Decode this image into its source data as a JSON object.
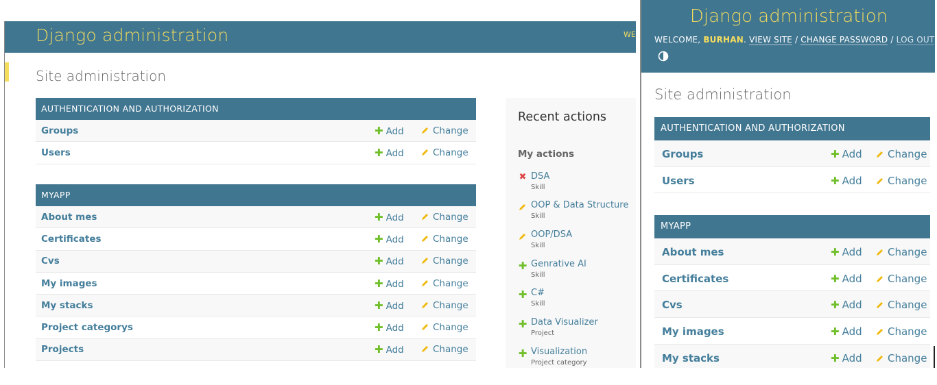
{
  "left": {
    "brand": "Django administration",
    "user_tools_fragment": "WE",
    "page_title": "Site administration",
    "modules": [
      {
        "caption": "AUTHENTICATION AND AUTHORIZATION",
        "models": [
          {
            "name": "Groups",
            "add": "Add",
            "change": "Change"
          },
          {
            "name": "Users",
            "add": "Add",
            "change": "Change"
          }
        ]
      },
      {
        "caption": "MYAPP",
        "models": [
          {
            "name": "About mes",
            "add": "Add",
            "change": "Change"
          },
          {
            "name": "Certificates",
            "add": "Add",
            "change": "Change"
          },
          {
            "name": "Cvs",
            "add": "Add",
            "change": "Change"
          },
          {
            "name": "My images",
            "add": "Add",
            "change": "Change"
          },
          {
            "name": "My stacks",
            "add": "Add",
            "change": "Change"
          },
          {
            "name": "Project categorys",
            "add": "Add",
            "change": "Change"
          },
          {
            "name": "Projects",
            "add": "Add",
            "change": "Change"
          }
        ]
      }
    ],
    "recent": {
      "title": "Recent actions",
      "subtitle": "My actions",
      "items": [
        {
          "icon": "delete-icon",
          "name": "DSA",
          "type": "Skill"
        },
        {
          "icon": "change-icon",
          "name": "OOP & Data Structure",
          "type": "Skill"
        },
        {
          "icon": "change-icon",
          "name": "OOP/DSA",
          "type": "Skill"
        },
        {
          "icon": "add-icon",
          "name": "Genrative AI",
          "type": "Skill"
        },
        {
          "icon": "add-icon",
          "name": "C#",
          "type": "Skill"
        },
        {
          "icon": "add-icon",
          "name": "Data Visualizer",
          "type": "Project"
        },
        {
          "icon": "add-icon",
          "name": "Visualization",
          "type": "Project category"
        }
      ]
    }
  },
  "right": {
    "brand": "Django administration",
    "user_tools": {
      "welcome": "WELCOME,",
      "username": "BURHAN",
      "view_site": "VIEW SITE",
      "sep": "/",
      "change_password": "CHANGE PASSWORD",
      "log_out": "LOG OUT"
    },
    "theme_toggle_icon": "half-circle-contrast-icon",
    "page_title": "Site administration",
    "modules": [
      {
        "caption": "AUTHENTICATION AND AUTHORIZATION",
        "models": [
          {
            "name": "Groups",
            "add": "Add",
            "change": "Change"
          },
          {
            "name": "Users",
            "add": "Add",
            "change": "Change"
          }
        ]
      },
      {
        "caption": "MYAPP",
        "models": [
          {
            "name": "About mes",
            "add": "Add",
            "change": "Change"
          },
          {
            "name": "Certificates",
            "add": "Add",
            "change": "Change"
          },
          {
            "name": "Cvs",
            "add": "Add",
            "change": "Change"
          },
          {
            "name": "My images",
            "add": "Add",
            "change": "Change"
          },
          {
            "name": "My stacks",
            "add": "Add",
            "change": "Change"
          }
        ]
      }
    ]
  },
  "colors": {
    "header_bg": "#417690",
    "brand_yellow": "#f5dd5d",
    "link_blue": "#447e9b",
    "add_green": "#70bf2b",
    "change_yellow": "#efb80b",
    "delete_red": "#dd4646"
  }
}
